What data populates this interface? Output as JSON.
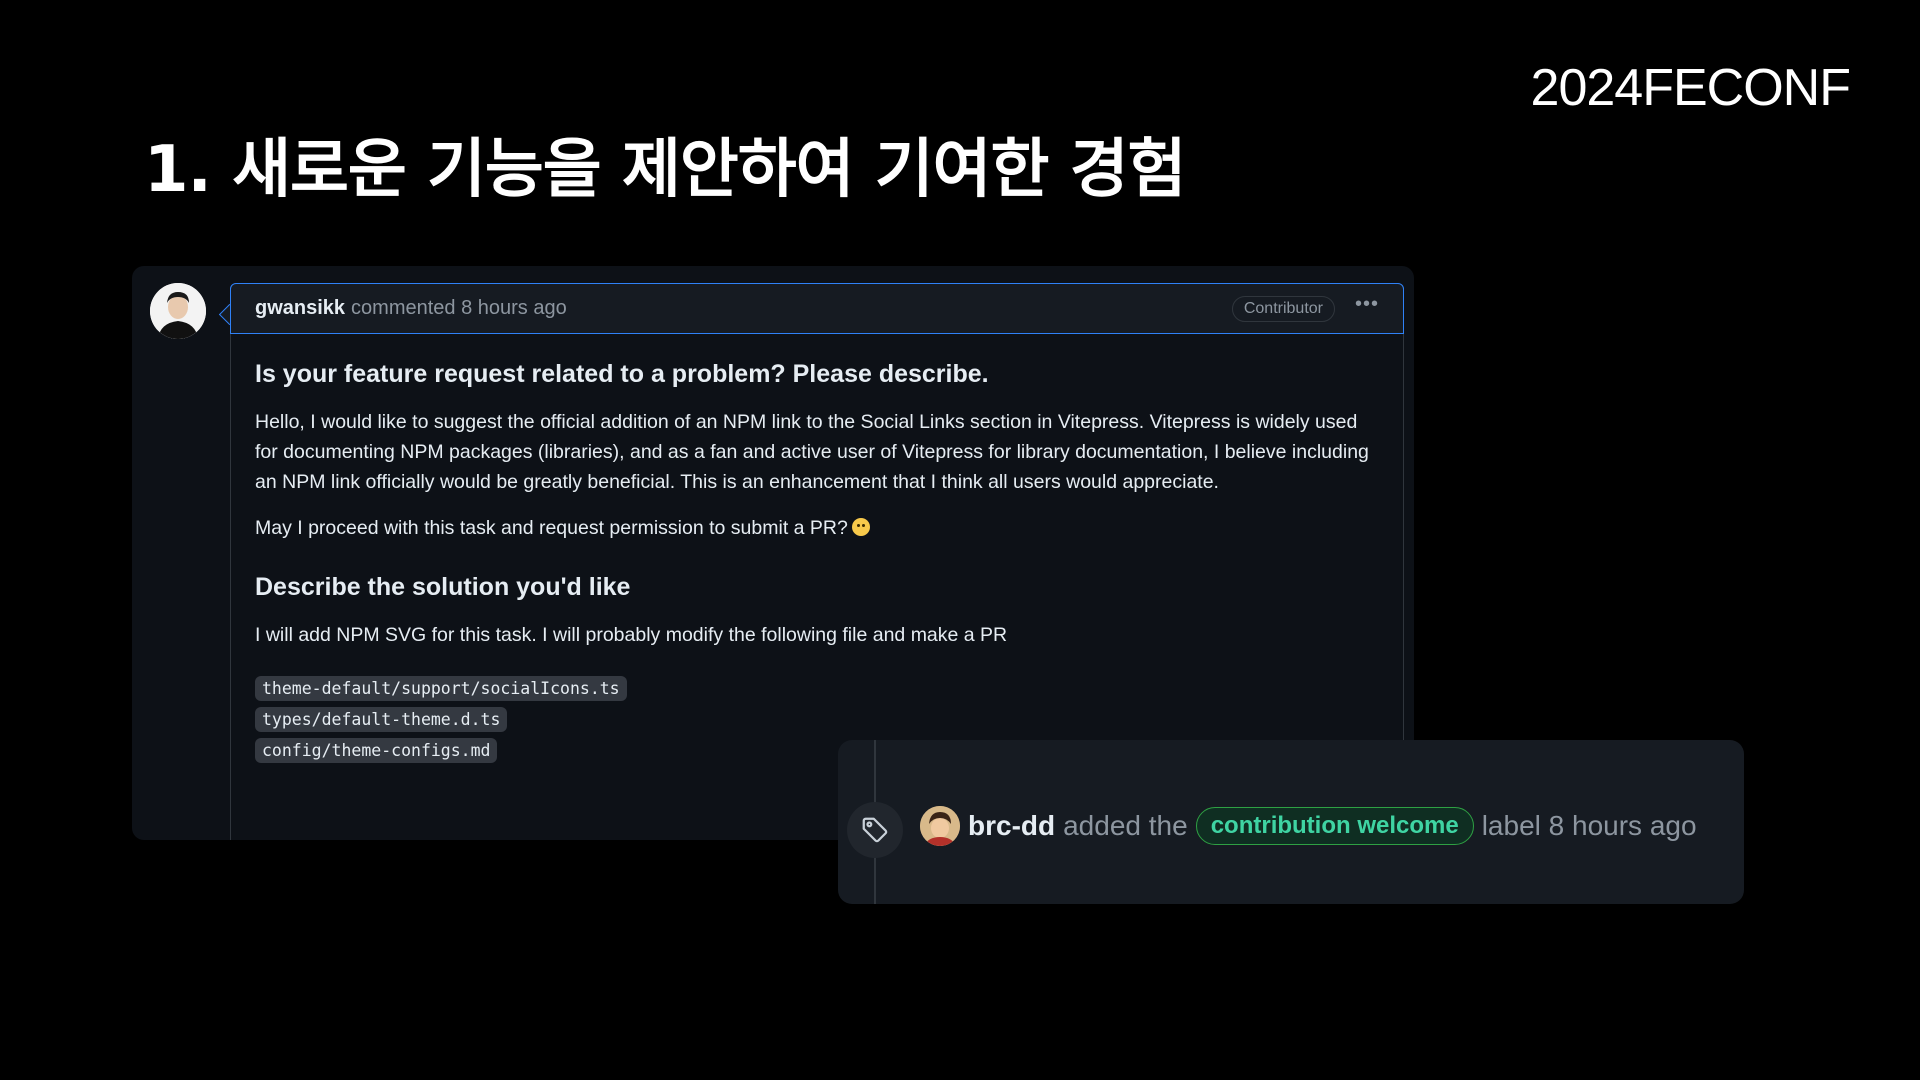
{
  "slide": {
    "brand": "2024FECONF",
    "title": "1. 새로운 기능을 제안하여 기여한 경험"
  },
  "comment": {
    "author": "gwansikk",
    "meta": "commented 8 hours ago",
    "role_badge": "Contributor",
    "more_icon": "kebab-horizontal-icon",
    "heading1": "Is your feature request related to a problem? Please describe.",
    "paragraph1": "Hello, I would like to suggest the official addition of an NPM link to the Social Links section in Vitepress. Vitepress is widely used for documenting NPM packages (libraries), and as a fan and active user of Vitepress for library documentation, I believe including an NPM link officially would be greatly beneficial. This is an enhancement that I think all users would appreciate.",
    "paragraph2": "May I proceed with this task and request permission to submit a PR?",
    "heading2": "Describe the solution you'd like",
    "paragraph3": "I will add NPM SVG for this task. I will probably modify the following file and make a PR",
    "files": [
      "theme-default/support/socialIcons.ts",
      "types/default-theme.d.ts",
      "config/theme-configs.md"
    ]
  },
  "event": {
    "icon": "tag-icon",
    "author": "brc-dd",
    "action": "added the",
    "label": "contribution welcome",
    "suffix": "label 8 hours ago",
    "label_color": "#3fd4a3"
  }
}
